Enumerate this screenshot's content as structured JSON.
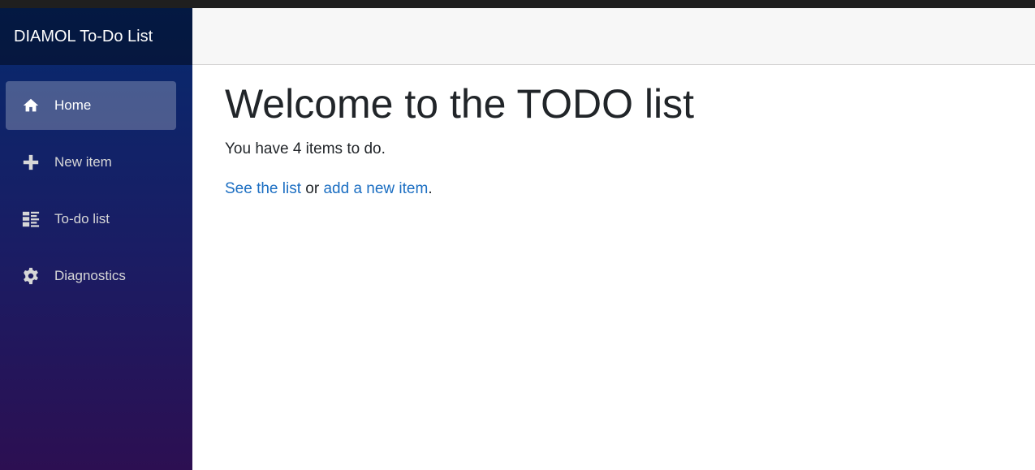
{
  "app": {
    "brand": "DIAMOL To-Do List"
  },
  "sidebar": {
    "items": [
      {
        "label": "Home",
        "icon": "home-icon",
        "active": true
      },
      {
        "label": "New item",
        "icon": "plus-icon",
        "active": false
      },
      {
        "label": "To-do list",
        "icon": "list-icon",
        "active": false
      },
      {
        "label": "Diagnostics",
        "icon": "gear-icon",
        "active": false
      }
    ]
  },
  "main": {
    "title": "Welcome to the TODO list",
    "summary": "You have 4 items to do.",
    "links": {
      "see_list": "See the list",
      "connector": "or",
      "add_item": "add a new item",
      "end": "."
    }
  },
  "colors": {
    "link": "#1b6ec2",
    "sidebar_top": "#062a6e",
    "sidebar_bottom": "#2c0f52"
  }
}
